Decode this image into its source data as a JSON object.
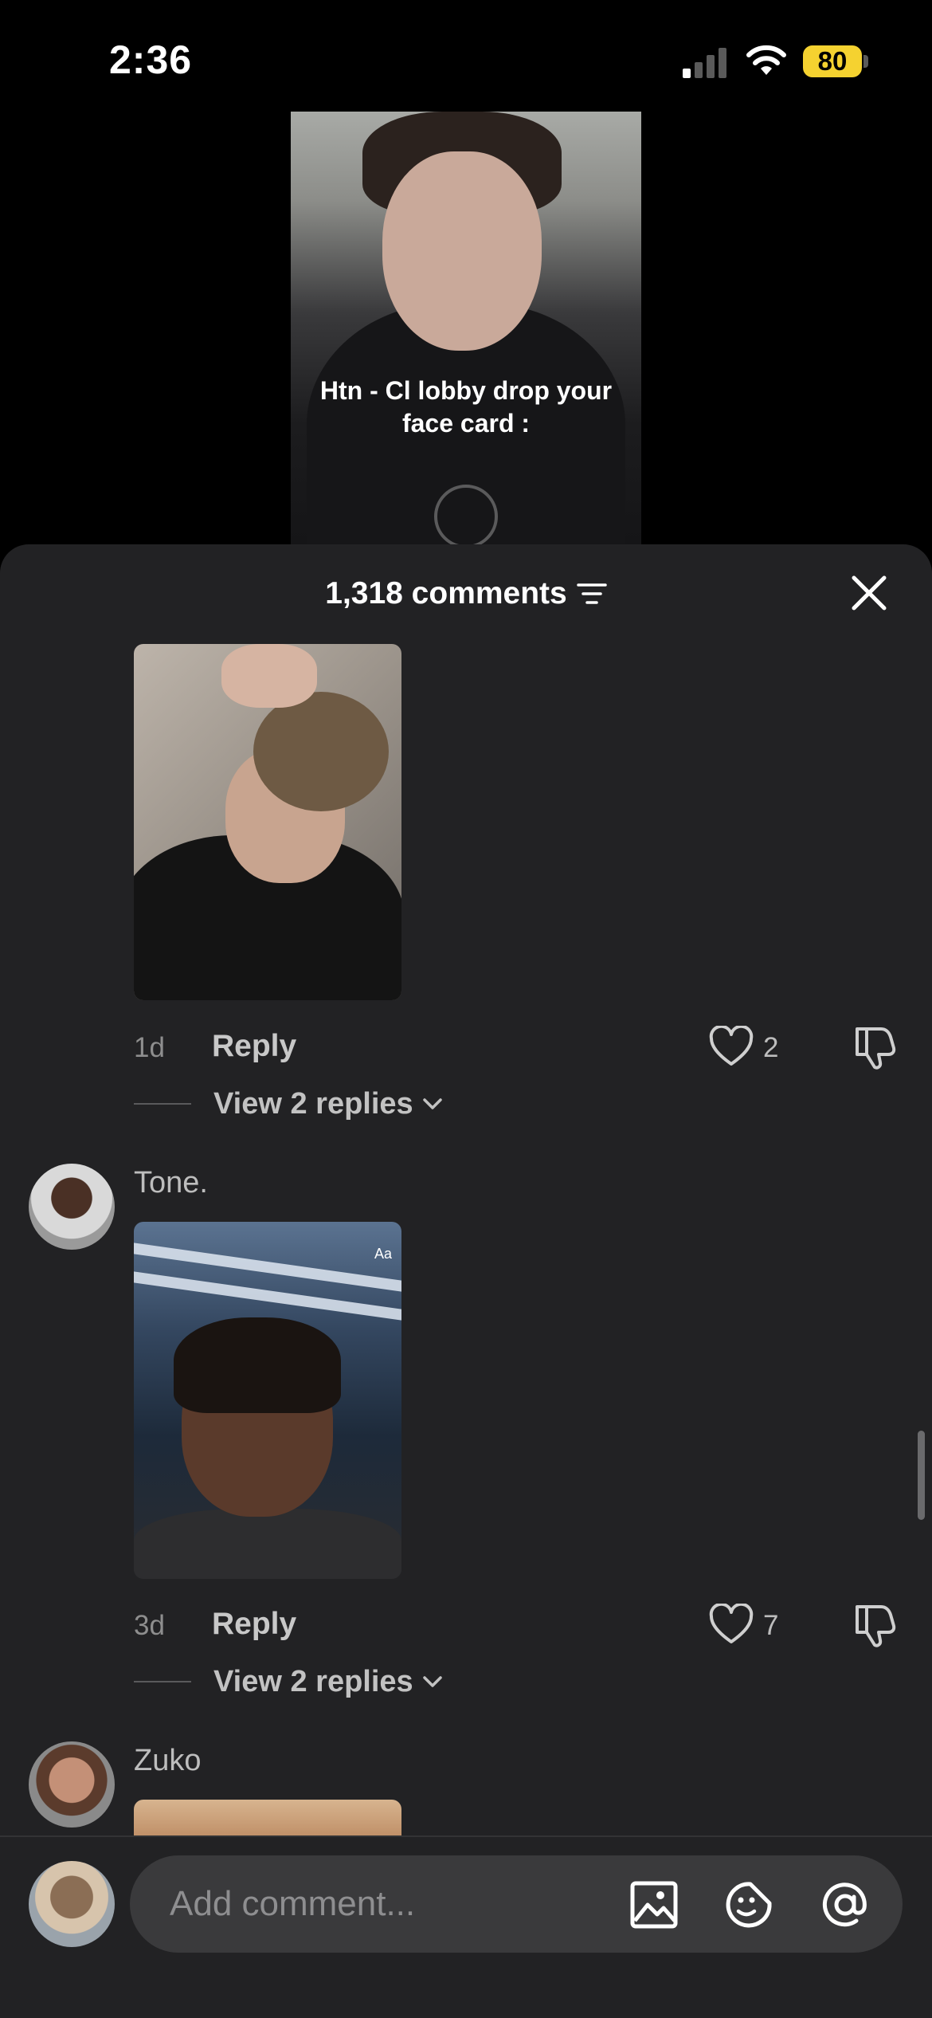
{
  "status_bar": {
    "time": "2:36",
    "battery": "80",
    "battery_color": "#f5d230"
  },
  "video": {
    "caption_line1": "Htn - Cl lobby drop your",
    "caption_line2": "face card :"
  },
  "sheet": {
    "comments_count": "1,318 comments",
    "filter_icon": "filter-icon",
    "close_icon": "close-icon"
  },
  "comments": [
    {
      "username": "",
      "timestamp": "1d",
      "reply_label": "Reply",
      "likes": "2",
      "view_replies": "View 2 replies"
    },
    {
      "username": "Tone.",
      "timestamp": "3d",
      "reply_label": "Reply",
      "likes": "7",
      "view_replies": "View 2 replies",
      "media_text": "Aa"
    },
    {
      "username": "Zuko"
    }
  ],
  "input": {
    "placeholder": "Add comment...",
    "icons": [
      "image-icon",
      "emoji-icon",
      "mention-icon"
    ]
  }
}
